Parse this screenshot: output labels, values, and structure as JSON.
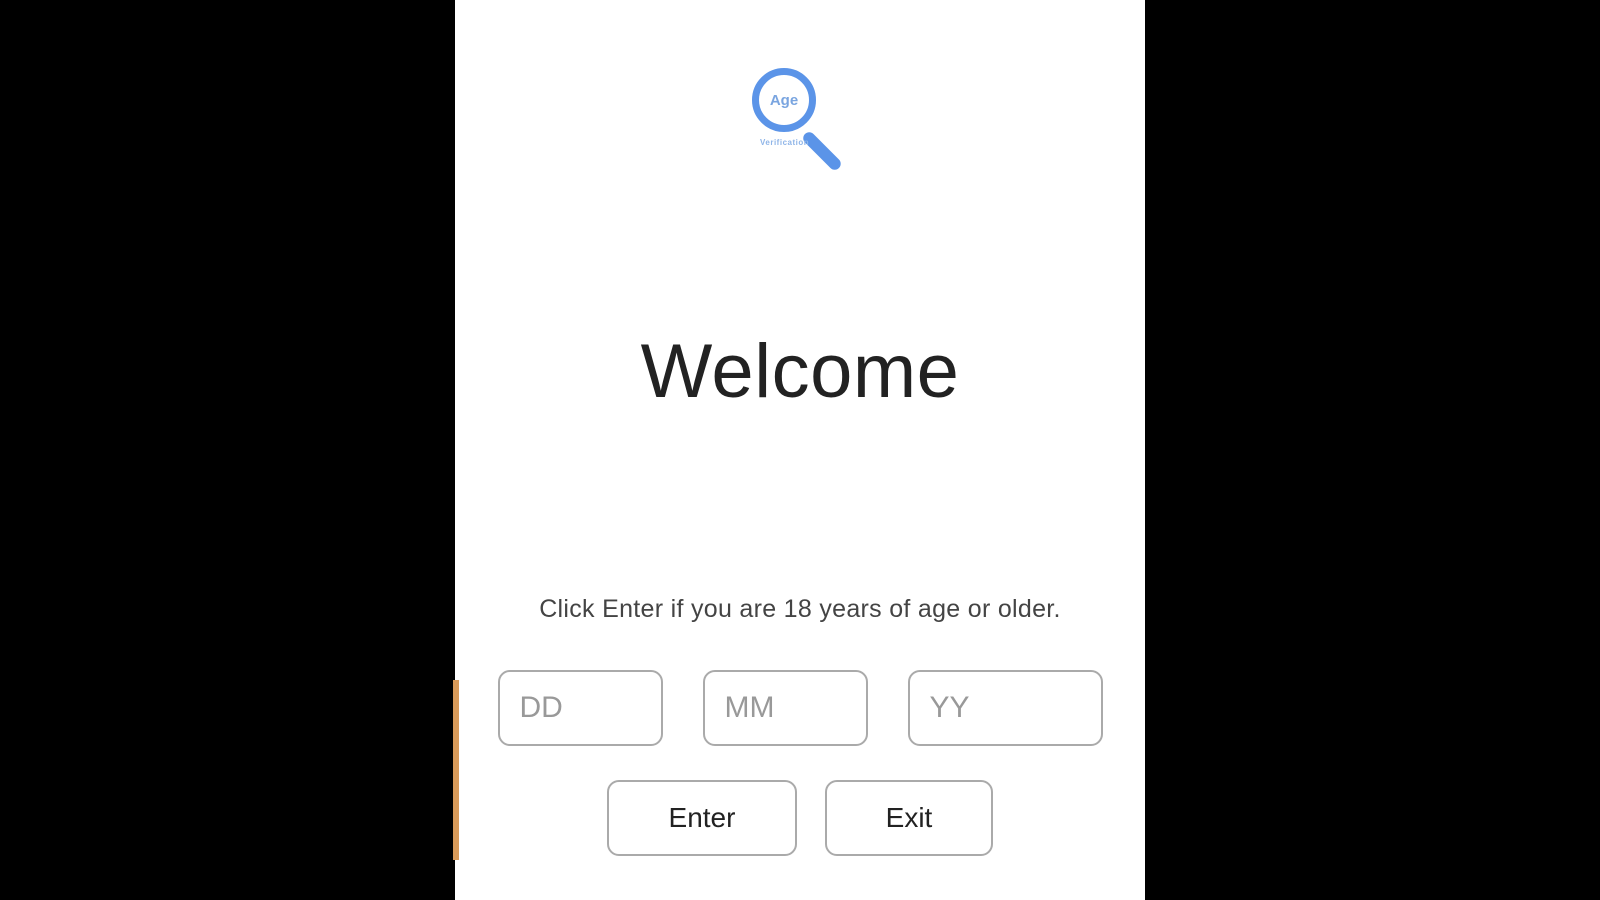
{
  "logo": {
    "circle_text": "Age",
    "subtext": "Verification"
  },
  "title": "Welcome",
  "subtitle": "Click Enter if you are 18 years of age or older.",
  "date_inputs": {
    "day_placeholder": "DD",
    "month_placeholder": "MM",
    "year_placeholder": "YY"
  },
  "buttons": {
    "enter_label": "Enter",
    "exit_label": "Exit"
  }
}
